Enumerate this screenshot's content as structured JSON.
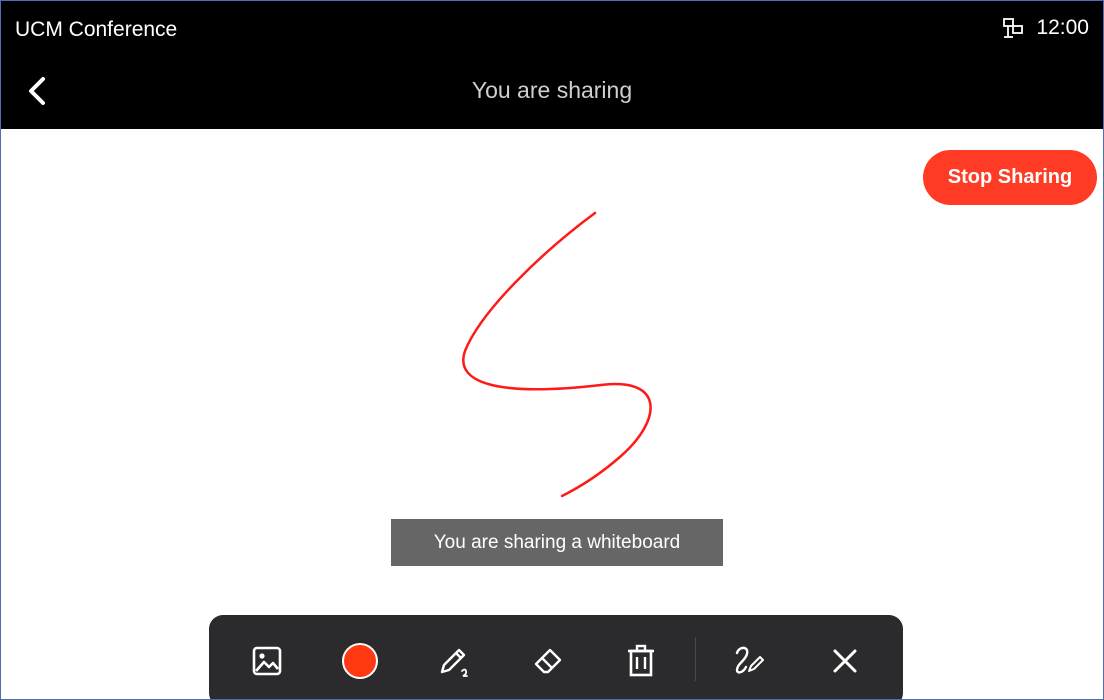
{
  "statusbar": {
    "app_name": "UCM Conference",
    "time": "12:00"
  },
  "header": {
    "title": "You are sharing"
  },
  "actions": {
    "stop_sharing_label": "Stop Sharing"
  },
  "toast": {
    "text": "You are sharing a whiteboard"
  },
  "colors": {
    "accent": "#ff3b25",
    "pen_color": "#ff3a12",
    "stroke": "#ff1a1a"
  },
  "toolbar": {
    "tools": [
      "image-icon",
      "color-picker",
      "pen-icon",
      "eraser-icon",
      "trash-icon",
      "annotate-icon",
      "close-icon"
    ]
  }
}
